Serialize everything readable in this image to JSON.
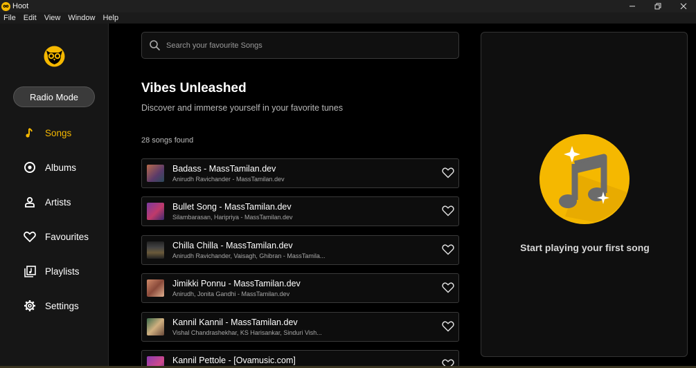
{
  "window": {
    "title": "Hoot",
    "controls": [
      "minimize",
      "restore",
      "close"
    ]
  },
  "menu": [
    "File",
    "Edit",
    "View",
    "Window",
    "Help"
  ],
  "sidebar": {
    "radio_mode": "Radio Mode",
    "items": [
      {
        "label": "Songs",
        "icon": "music-note-icon",
        "active": true
      },
      {
        "label": "Albums",
        "icon": "disc-icon"
      },
      {
        "label": "Artists",
        "icon": "person-icon"
      },
      {
        "label": "Favourites",
        "icon": "heart-icon"
      },
      {
        "label": "Playlists",
        "icon": "playlist-icon"
      },
      {
        "label": "Settings",
        "icon": "gear-icon"
      }
    ]
  },
  "search": {
    "placeholder": "Search your favourite Songs"
  },
  "main": {
    "heading": "Vibes Unleashed",
    "subheading": "Discover and immerse yourself in your favorite tunes",
    "count": "28 songs found"
  },
  "songs": [
    {
      "title": "Badass - MassTamilan.dev",
      "artist": "Anirudh Ravichander - MassTamilan.dev"
    },
    {
      "title": "Bullet Song - MassTamilan.dev",
      "artist": "Silambarasan, Haripriya - MassTamilan.dev"
    },
    {
      "title": "Chilla Chilla - MassTamilan.dev",
      "artist": "Anirudh Ravichander, Vaisagh, Ghibran - MassTamila..."
    },
    {
      "title": "Jimikki Ponnu - MassTamilan.dev",
      "artist": "Anirudh, Jonita Gandhi - MassTamilan.dev"
    },
    {
      "title": "Kannil Kannil - MassTamilan.dev",
      "artist": "Vishal Chandrashekhar, KS Harisankar, Sinduri Vish..."
    },
    {
      "title": "Kannil Pettole - [Ovamusic.com]",
      "artist": ""
    }
  ],
  "player": {
    "empty_text": "Start playing your first song"
  },
  "colors": {
    "accent": "#f5b800",
    "background": "#000000",
    "sidebar": "#161616"
  }
}
